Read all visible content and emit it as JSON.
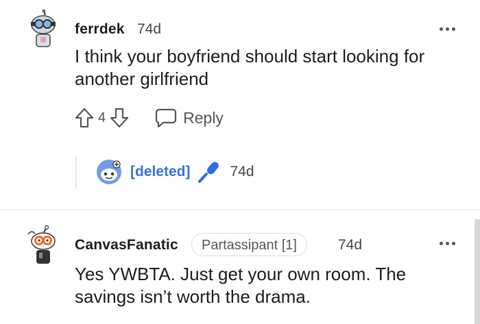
{
  "comments": [
    {
      "username": "ferrdek",
      "time": "74d",
      "text_line1": "I think your boyfriend should start looking for",
      "text_line2": "another girlfriend",
      "vote_count": "4",
      "reply_label": "Reply"
    },
    {
      "username": "CanvasFanatic",
      "flair": "Partassipant [1]",
      "time": "74d",
      "text_line1": "Yes YWBTA. Just get your own room. The",
      "text_line2": "savings isn’t worth the drama."
    }
  ],
  "deleted_reply": {
    "label": "[deleted]",
    "time": "74d"
  },
  "colors": {
    "deleted_link": "#3b6fd8",
    "mic_accent": "#2f6fe0",
    "text": "#1c1c1c",
    "muted": "#555555"
  },
  "icons": {
    "upvote": "upvote-arrow-icon",
    "downvote": "downvote-arrow-icon",
    "reply": "speech-bubble-icon",
    "more": "ellipsis-icon",
    "mic": "microphone-icon"
  }
}
